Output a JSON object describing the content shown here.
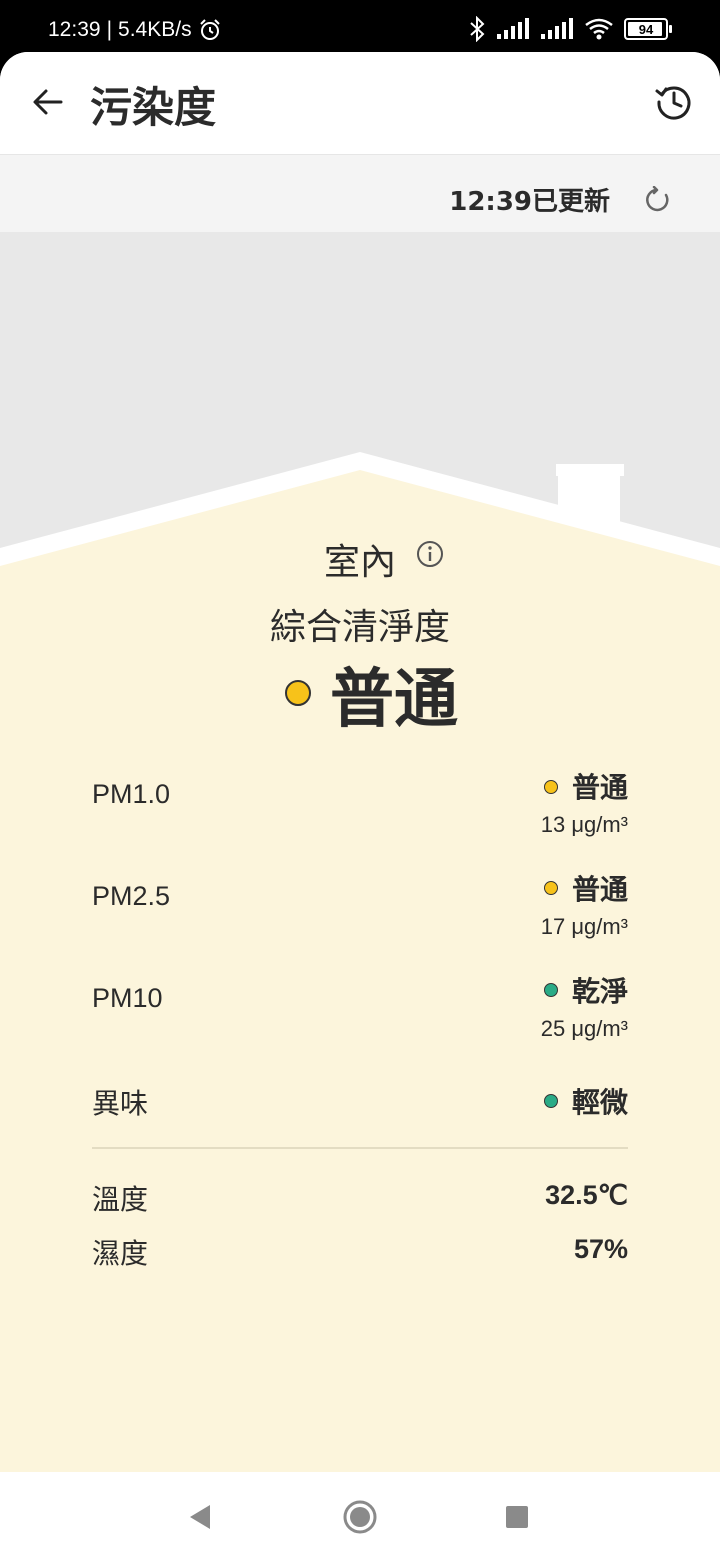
{
  "status_bar": {
    "time": "12:39",
    "speed": "5.4KB/s",
    "battery_level": "94",
    "battery_fraction": 0.94
  },
  "header": {
    "title": "污染度"
  },
  "update": {
    "text": "12:39已更新"
  },
  "summary": {
    "location": "室內",
    "overall_label": "綜合清淨度",
    "overall_value": "普通",
    "overall_color": "#f7c21a"
  },
  "metrics": [
    {
      "name": "PM1.0",
      "status": "普通",
      "value": "13 μg/m³",
      "color": "#f7c21a"
    },
    {
      "name": "PM2.5",
      "status": "普通",
      "value": "17 μg/m³",
      "color": "#f7c21a"
    },
    {
      "name": "PM10",
      "status": "乾淨",
      "value": "25 μg/m³",
      "color": "#2aab86"
    },
    {
      "name": "異味",
      "status": "輕微",
      "color": "#2aab86"
    }
  ],
  "environment": {
    "temperature_label": "溫度",
    "temperature_value": "32.5℃",
    "humidity_label": "濕度",
    "humidity_value": "57%"
  },
  "colors": {
    "house_fill": "#fcf5dc",
    "sky": "#e8e8e8",
    "update_bar": "#f4f4f4"
  },
  "icons": [
    "back-arrow-icon",
    "history-icon",
    "refresh-icon",
    "info-icon",
    "alarm-icon",
    "bluetooth-icon",
    "signal-icon",
    "wifi-icon",
    "battery-icon",
    "nav-back-icon",
    "nav-home-icon",
    "nav-recents-icon"
  ]
}
